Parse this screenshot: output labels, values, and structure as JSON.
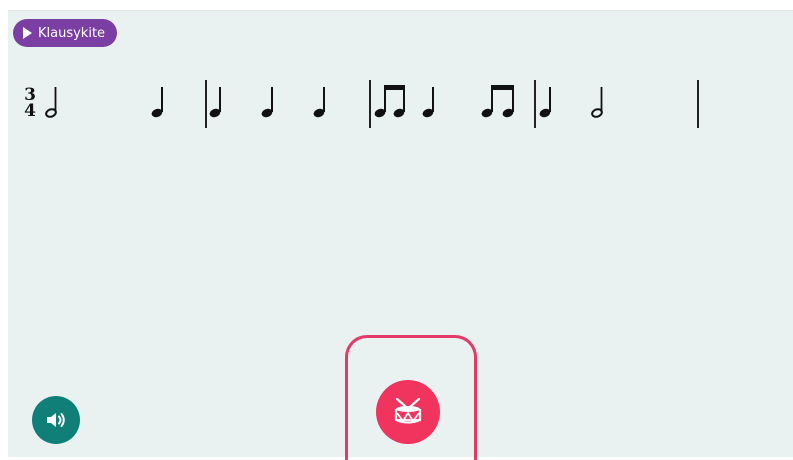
{
  "listen_button": {
    "label": "Klausykite",
    "color": "#7b3fa4"
  },
  "score": {
    "time_signature": {
      "top": "3",
      "bottom": "4"
    },
    "measures": [
      [
        "half",
        "quarter"
      ],
      [
        "quarter",
        "quarter",
        "quarter"
      ],
      [
        "eighth-pair",
        "quarter",
        "eighth-pair"
      ],
      [
        "quarter",
        "half"
      ]
    ]
  },
  "sound_button": {
    "icon": "speaker-icon",
    "color": "#0f7f78"
  },
  "drum_button": {
    "icon": "drum-icon",
    "color": "#f0345e",
    "frame_color": "#e33a68"
  }
}
